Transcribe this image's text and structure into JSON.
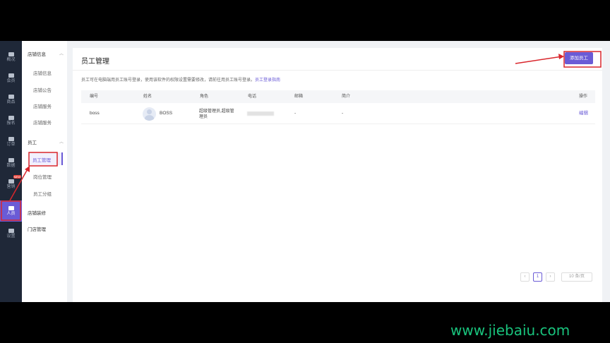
{
  "rail": {
    "items": [
      {
        "label": "概况",
        "icon": "overview-icon"
      },
      {
        "label": "会员",
        "icon": "diamond-icon"
      },
      {
        "label": "商品",
        "icon": "goods-icon"
      },
      {
        "label": "报名",
        "icon": "form-icon"
      },
      {
        "label": "订单",
        "icon": "order-icon"
      },
      {
        "label": "数据",
        "icon": "chart-icon"
      },
      {
        "label": "营销",
        "icon": "megaphone-icon",
        "badge": "NEW"
      },
      {
        "label": "人员",
        "icon": "people-icon"
      },
      {
        "label": "设置",
        "icon": "gear-icon"
      }
    ]
  },
  "sub": {
    "group1": "店铺信息",
    "group1_items": [
      "店铺信息",
      "店铺公告",
      "店铺服务",
      "店铺服务"
    ],
    "group2": "员工",
    "group2_items": [
      "员工管理",
      "岗位管理",
      "员工分组"
    ],
    "extra_items": [
      "店铺装修",
      "门店管理"
    ]
  },
  "main": {
    "title": "员工管理",
    "add_button": "添加员工",
    "tip": "员工可在电脑端用员工账号登录，使用该软件的权限设置需要修改，请前往用员工账号登录。",
    "tip_link": "员工登录指南",
    "columns": [
      "编号",
      "姓名",
      "角色",
      "电话",
      "邮箱",
      "简介",
      "操作"
    ],
    "rows": [
      {
        "id": "boss",
        "name": "BOSS",
        "role": "超级管理员,超级管理员",
        "phone": "",
        "email": "-",
        "intro": "-",
        "action": "编辑"
      }
    ],
    "pager": {
      "current": "1",
      "page_size": "10 条/页"
    }
  },
  "watermark": "www.jiebaiu.com",
  "colors": {
    "accent": "#6a5bd6",
    "annotation": "#d9262c",
    "rail": "#1f2838"
  }
}
